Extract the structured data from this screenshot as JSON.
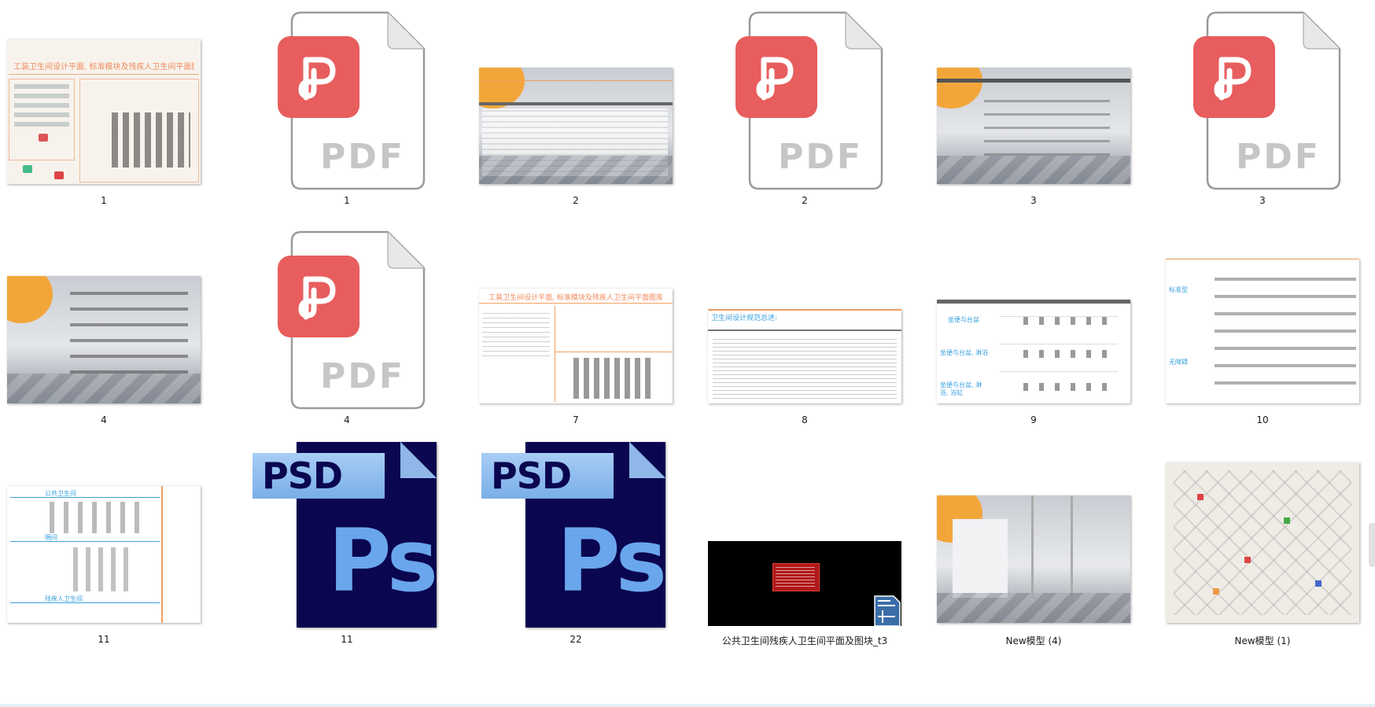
{
  "items": [
    {
      "label": "1",
      "type": "image-plan-collage"
    },
    {
      "label": "1",
      "type": "pdf",
      "icon_text": "PDF"
    },
    {
      "label": "2",
      "type": "image-scene-doc"
    },
    {
      "label": "2",
      "type": "pdf",
      "icon_text": "PDF"
    },
    {
      "label": "3",
      "type": "image-scene-doc"
    },
    {
      "label": "3",
      "type": "pdf",
      "icon_text": "PDF"
    },
    {
      "label": "4",
      "type": "image-scene-doc"
    },
    {
      "label": "4",
      "type": "pdf",
      "icon_text": "PDF"
    },
    {
      "label": "7",
      "type": "image-layout"
    },
    {
      "label": "8",
      "type": "image-layout"
    },
    {
      "label": "9",
      "type": "image-layout"
    },
    {
      "label": "10",
      "type": "image-layout"
    },
    {
      "label": "11",
      "type": "image-layout"
    },
    {
      "label": "11",
      "type": "psd",
      "tag_text": "PSD",
      "logo_text": "Ps"
    },
    {
      "label": "22",
      "type": "psd",
      "tag_text": "PSD",
      "logo_text": "Ps"
    },
    {
      "label": "公共卫生间残疾人卫生间平面及图块_t3",
      "type": "dwg"
    },
    {
      "label": "New模型 (4)",
      "type": "image-scene"
    },
    {
      "label": "New模型 (1)",
      "type": "image-iso-collage"
    }
  ],
  "thumb_text": {
    "title_1": "工装卫生间设计平面, 标准模块及残疾人卫生间平面图库",
    "title_7": "工装卫生间设计平面, 标准模块及残疾人卫生间平面图库",
    "title_8": "卫生间设计规范总述:",
    "t9_row1": "坐便与台盆",
    "t9_row2": "坐便与台盆, 淋浴",
    "t9_row3": "坐便与台盆, 淋浴, 浴缸",
    "t10_left1": "标准型",
    "t10_left2": "无障碍",
    "t11_head1": "公共卫生间",
    "t11_head2": "隔间",
    "t11_head3": "残疾人卫生间"
  },
  "colors": {
    "pdf_badge": "#e85d5d",
    "psd_bg": "#0a0650",
    "psd_tag": "#8fbcef",
    "accent_orange": "#f08a5d",
    "accent_blue": "#3aa0e0"
  }
}
